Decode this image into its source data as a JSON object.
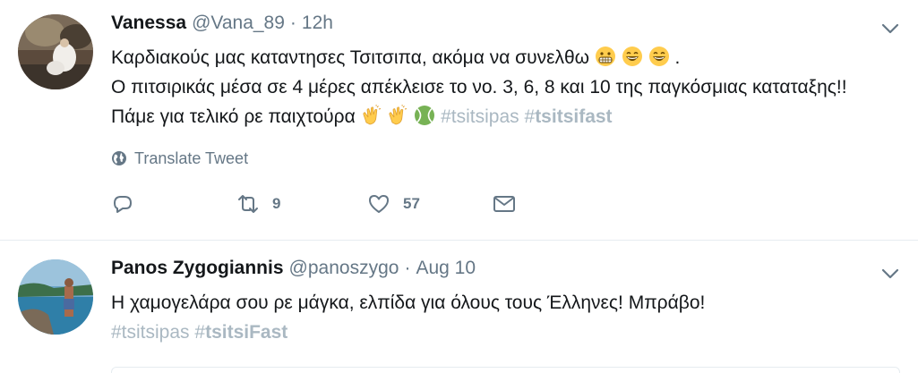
{
  "tweets": [
    {
      "fullname": "Vanessa",
      "handle": "@Vana_89",
      "separator": "·",
      "time": "12h",
      "text_line1": "Καρδιακούς μας καταντησες Τσιτσιπα, ακόμα να συνελθω",
      "text_line1_end": " .",
      "text_line2": "Ο πιτσιρικάς μέσα σε 4 μέρες απέκλεισε το νο. 3, 6, 8 και 10 της παγκόσμιας καταταξης!! Πάμε για τελικό ρε παιχτούρα",
      "hashtag1": "#tsitsipas",
      "hashtag2_hash": "#",
      "hashtag2_word": "tsitsifast",
      "translate_label": "Translate Tweet",
      "retweets": "9",
      "likes": "57",
      "icons": [
        "chevron-down-icon",
        "grimacing-emoji",
        "grin-emoji",
        "clap-emoji",
        "tennis-ball-emoji",
        "globe-icon",
        "reply-icon",
        "retweet-icon",
        "heart-icon",
        "mail-icon"
      ]
    },
    {
      "fullname": "Panos Zygogiannis",
      "handle": "@panoszygo",
      "separator": "·",
      "time": "Aug 10",
      "text": "Η χαμογελάρα σου ρε μάγκα, ελπίδα για όλους τους Έλληνες! Μπράβο!",
      "hashtag1": "#tsitsipas",
      "hashtag2_hash": "#",
      "hashtag2_word": "tsitsiFast"
    }
  ],
  "colors": {
    "text": "#14171a",
    "secondary": "#657786",
    "hashtag": "#aab8c2",
    "divider": "#e6ecf0"
  }
}
